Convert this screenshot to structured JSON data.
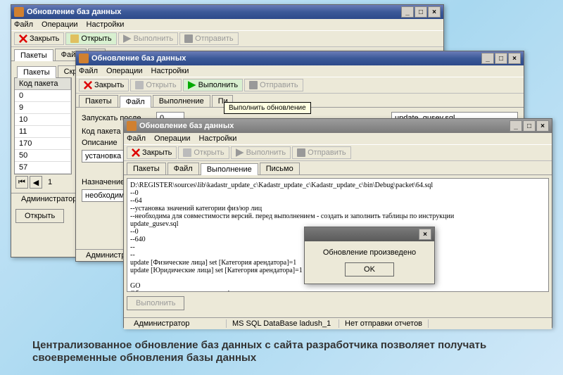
{
  "window_title": "Обновление баз данных",
  "menu": {
    "file": "Файл",
    "ops": "Операции",
    "settings": "Настройки"
  },
  "toolbar": {
    "close": "Закрыть",
    "open": "Открыть",
    "run": "Выполнить",
    "send": "Отправить"
  },
  "tabs": {
    "packets": "Пакеты",
    "file": "Файл",
    "exec": "Выполнение",
    "letter": "Письмо",
    "scripts": "Скрипты",
    "v": "В"
  },
  "grid": {
    "header": "Код пакета",
    "rows": [
      "0",
      "9",
      "10",
      "11",
      "170",
      "50",
      "57"
    ]
  },
  "pager": {
    "page": "1"
  },
  "fields": {
    "run_after": "Запускать после",
    "run_after_val": "0",
    "run_after_file": "update_gusev.sql",
    "code": "Код пакета",
    "desc": "Описание",
    "desc_val": "установка зн",
    "dest": "Назначение",
    "dest_val": "необходима д"
  },
  "status": {
    "admin": "Администратор",
    "db": "MS SQL DataBase ladush_1",
    "reports": "Нет отправки отчетов"
  },
  "buttons": {
    "open": "Открыть",
    "run": "Выполнить"
  },
  "tooltip": "Выполнить обновление",
  "log": "D:\\REGISTER\\sources\\lib\\kadastr_update_c\\Kadastr_update_c\\Kadastr_update_c\\bin\\Debug\\packet\\64.sql\n--0\n--64\n--установка значений категории физ/юр лиц\n--необходима для совместимости версий. перед выполнением - создать и заполнить таблицы по инструкции\nupdate_gusev.sql\n--0\n--640\n--\n--\nupdate [Физические лица] set [Категория арендатора]=1\nupdate [Юридические лица] set [Категория арендатора]=1\n\nGO\nОбновление проведено успешно!",
  "dialog": {
    "msg": "Обновление произведено",
    "ok": "OK"
  },
  "caption": "Централизованное обновление баз данных с сайта разработчика позволяет получать своевременные обновления базы данных",
  "winbtns": {
    "min": "_",
    "max": "□",
    "close": "×"
  }
}
